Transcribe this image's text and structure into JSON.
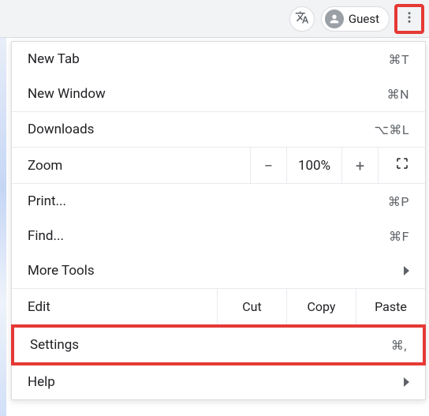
{
  "toolbar": {
    "guest_label": "Guest"
  },
  "menu": {
    "new_tab": {
      "label": "New Tab",
      "shortcut": "⌘T"
    },
    "new_window": {
      "label": "New Window",
      "shortcut": "⌘N"
    },
    "downloads": {
      "label": "Downloads",
      "shortcut": "⌥⌘L"
    },
    "zoom": {
      "label": "Zoom",
      "minus": "−",
      "value": "100%",
      "plus": "+"
    },
    "print": {
      "label": "Print...",
      "shortcut": "⌘P"
    },
    "find": {
      "label": "Find...",
      "shortcut": "⌘F"
    },
    "more_tools": {
      "label": "More Tools"
    },
    "edit": {
      "label": "Edit",
      "cut": "Cut",
      "copy": "Copy",
      "paste": "Paste"
    },
    "settings": {
      "label": "Settings",
      "shortcut": "⌘,"
    },
    "help": {
      "label": "Help"
    }
  }
}
